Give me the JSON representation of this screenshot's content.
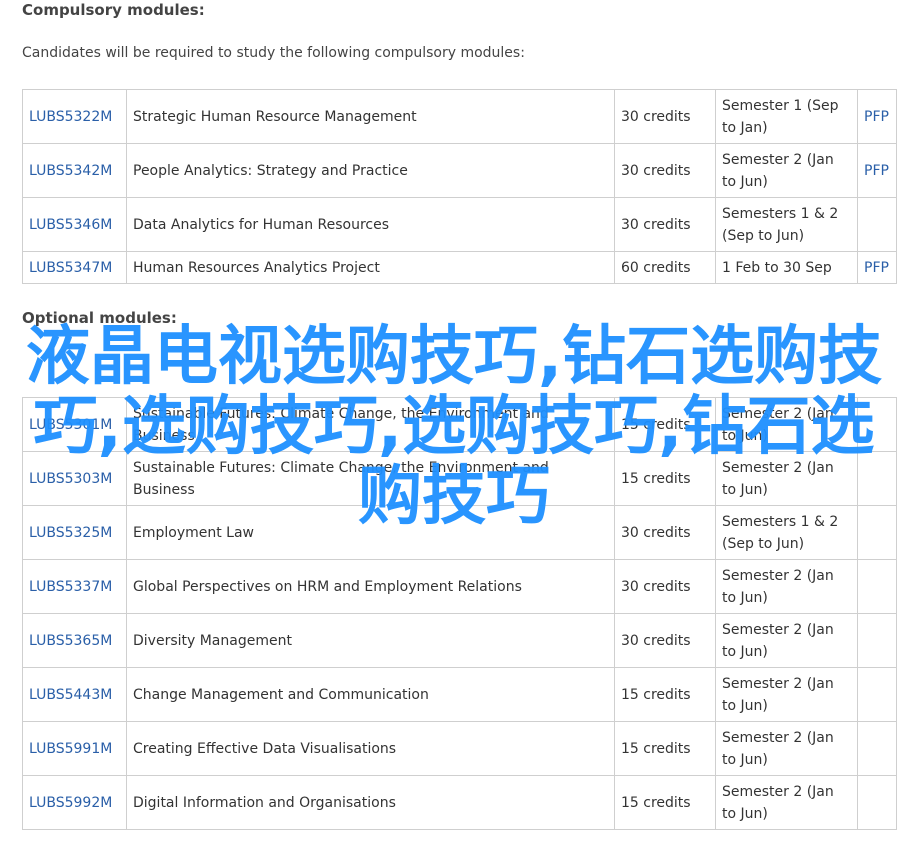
{
  "compulsory": {
    "heading": "Compulsory modules:",
    "intro": "Candidates will be required to study the following compulsory modules:",
    "rows": [
      {
        "code": "LUBS5322M",
        "title": "Strategic Human Resource Management",
        "credits": "30 credits",
        "semester": "Semester 1 (Sep to Jan)",
        "pfp": "PFP"
      },
      {
        "code": "LUBS5342M",
        "title": "People Analytics: Strategy and Practice",
        "credits": "30 credits",
        "semester": "Semester 2 (Jan to Jun)",
        "pfp": "PFP"
      },
      {
        "code": "LUBS5346M",
        "title": "Data Analytics for Human Resources",
        "credits": "30 credits",
        "semester": "Semesters 1 & 2 (Sep to Jun)",
        "pfp": ""
      },
      {
        "code": "LUBS5347M",
        "title": "Human Resources Analytics Project",
        "credits": "60 credits",
        "semester": "1 Feb to 30 Sep",
        "pfp": "PFP"
      }
    ]
  },
  "optional": {
    "heading": "Optional modules:",
    "rows": [
      {
        "code": "LUBS5301M",
        "title": "Sustainable Futures: Climate Change, the Environment and Business",
        "credits": "15 credits",
        "semester": "Semester 2 (Jan to Jun)",
        "pfp": ""
      },
      {
        "code": "LUBS5303M",
        "title": "Sustainable Futures: Climate Change, the Environment and Business",
        "credits": "15 credits",
        "semester": "Semester 2 (Jan to Jun)",
        "pfp": ""
      },
      {
        "code": "LUBS5325M",
        "title": "Employment Law",
        "credits": "30 credits",
        "semester": "Semesters 1 & 2 (Sep to Jun)",
        "pfp": ""
      },
      {
        "code": "LUBS5337M",
        "title": "Global Perspectives on HRM and Employment Relations",
        "credits": "30 credits",
        "semester": "Semester 2 (Jan to Jun)",
        "pfp": ""
      },
      {
        "code": "LUBS5365M",
        "title": "Diversity Management",
        "credits": "30 credits",
        "semester": "Semester 2 (Jan to Jun)",
        "pfp": ""
      },
      {
        "code": "LUBS5443M",
        "title": "Change Management and Communication",
        "credits": "15 credits",
        "semester": "Semester 2 (Jan to Jun)",
        "pfp": ""
      },
      {
        "code": "LUBS5991M",
        "title": "Creating Effective Data Visualisations",
        "credits": "15 credits",
        "semester": "Semester 2 (Jan to Jun)",
        "pfp": ""
      },
      {
        "code": "LUBS5992M",
        "title": "Digital Information and Organisations",
        "credits": "15 credits",
        "semester": "Semester 2 (Jan to Jun)",
        "pfp": ""
      }
    ]
  },
  "overlay": {
    "text": "液晶电视选购技巧,钻石选购技巧,选购技巧,选购技巧,钻石选购技巧"
  },
  "colors": {
    "link": "#2a5fa8",
    "overlay": "#1e90ff",
    "border": "#cfcfcf"
  }
}
